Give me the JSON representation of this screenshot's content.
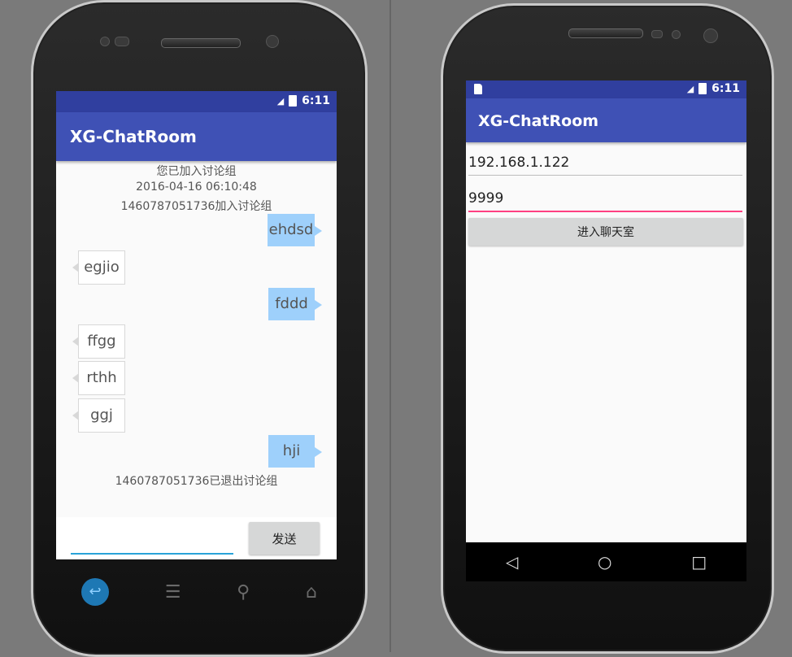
{
  "left_phone": {
    "status": {
      "network": "3G",
      "time": "6:11"
    },
    "app_title": "XG-ChatRoom",
    "system_messages": {
      "joined": "您已加入讨论组",
      "datetime": "2016-04-16 06:10:48",
      "user_joined": "1460787051736加入讨论组",
      "user_left": "1460787051736已退出讨论组"
    },
    "messages": [
      {
        "side": "right",
        "text": "ehdsd"
      },
      {
        "side": "left",
        "text": "egjio"
      },
      {
        "side": "right",
        "text": "fddd"
      },
      {
        "side": "left",
        "text": "ffgg"
      },
      {
        "side": "left",
        "text": "rthh"
      },
      {
        "side": "left",
        "text": "ggj"
      },
      {
        "side": "right",
        "text": "hji"
      }
    ],
    "input": {
      "value": "",
      "placeholder": ""
    },
    "send_label": "发送",
    "hardware_keys": [
      "back-icon",
      "menu-icon",
      "search-icon",
      "home-icon"
    ]
  },
  "right_phone": {
    "status": {
      "network": "3G",
      "time": "6:11"
    },
    "app_title": "XG-ChatRoom",
    "ip_field": {
      "value": "192.168.1.122"
    },
    "port_field": {
      "value": "9999"
    },
    "enter_label": "进入聊天室",
    "nav": {
      "back": "◁",
      "home": "○",
      "recents": "□"
    }
  },
  "colors": {
    "primary": "#3f51b5",
    "primary_dark": "#303f9f",
    "accent": "#ff4081",
    "bubble_right": "#9ed0fb"
  }
}
